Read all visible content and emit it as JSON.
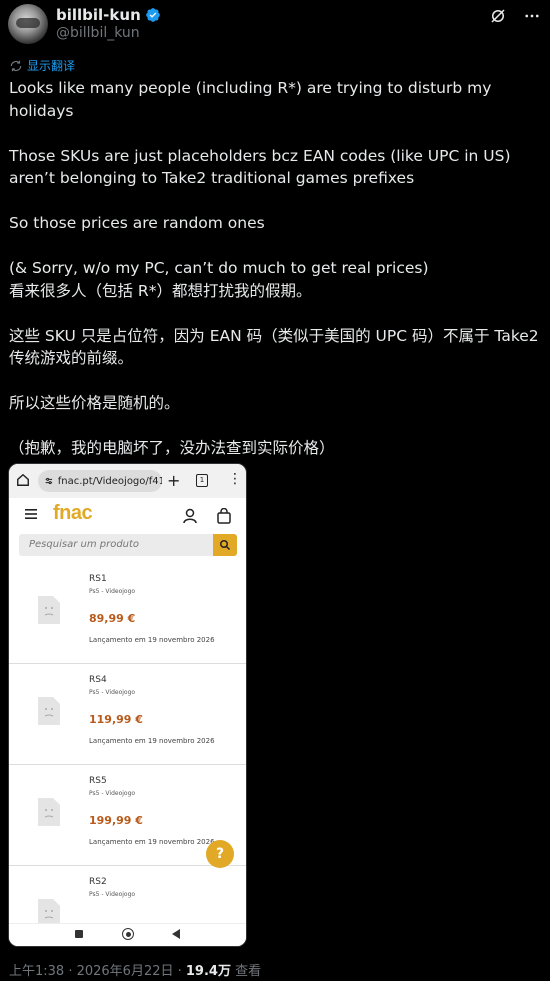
{
  "author": {
    "display_name": "billbil-kun",
    "handle": "@billbil_kun"
  },
  "translate_label": "显示翻译",
  "tweet": {
    "en": [
      "Looks like many people (including R*) are trying to disturb my holidays",
      "Those SKUs are just placeholders bcz EAN codes (like UPC in US) aren’t belonging to Take2 traditional games prefixes",
      "So those prices are random ones",
      "(& Sorry, w/o my PC, can’t do much to get real prices)"
    ],
    "zh": [
      "看来很多人（包括 R*）都想打扰我的假期。",
      "这些 SKU 只是占位符，因为 EAN 码（类似于美国的 UPC 码）不属于 Take2 传统游戏的前缀。",
      "所以这些价格是随机的。",
      "（抱歉，我的电脑坏了，没办法查到实际价格）"
    ]
  },
  "screenshot": {
    "url": "fnac.pt/Videojogo/f41",
    "tab_count": "1",
    "logo": "fnac",
    "search_placeholder": "Pesquisar um produto",
    "products": [
      {
        "title": "RS1",
        "category": "Ps5 - Videojogo",
        "price": "89,99 €",
        "release": "Lançamento em 19 novembro 2026"
      },
      {
        "title": "RS4",
        "category": "Ps5 - Videojogo",
        "price": "119,99 €",
        "release": "Lançamento em 19 novembro 2026"
      },
      {
        "title": "RS5",
        "category": "Ps5 - Videojogo",
        "price": "199,99 €",
        "release": "Lançamento em 19 novembro 2026"
      },
      {
        "title": "RS2",
        "category": "Ps5 - Videojogo",
        "price": "",
        "release": ""
      }
    ]
  },
  "footer": {
    "time_date": "上午1:38 · 2026年6月22日 · ",
    "views": "19.4万",
    "views_label": " 查看"
  },
  "colors": {
    "accent_blue": "#1d9bf0",
    "fnac_yellow": "#e1a925",
    "price_orange": "#b85a1a"
  },
  "icons": [
    "verified-badge-icon",
    "grok-icon",
    "more-icon",
    "translate-icon",
    "home-icon",
    "menu-icon",
    "user-icon",
    "bag-icon",
    "search-icon",
    "help-icon"
  ]
}
